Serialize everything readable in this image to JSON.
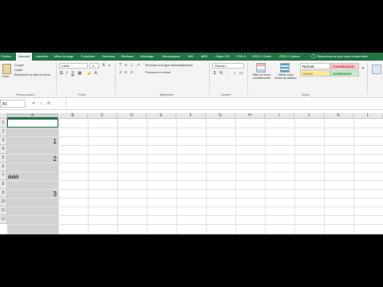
{
  "tabs": [
    {
      "label": "Fichier",
      "active": false
    },
    {
      "label": "Accueil",
      "active": true
    },
    {
      "label": "Insertion",
      "active": false
    },
    {
      "label": "Mise en page",
      "active": false
    },
    {
      "label": "Formules",
      "active": false
    },
    {
      "label": "Données",
      "active": false
    },
    {
      "label": "Révision",
      "active": false
    },
    {
      "label": "Affichage",
      "active": false
    },
    {
      "label": "Développeur",
      "active": false
    },
    {
      "label": "MR",
      "active": false
    },
    {
      "label": "MR2",
      "active": false
    },
    {
      "label": "Super FiC",
      "active": false
    },
    {
      "label": "OSS-X",
      "active": false
    },
    {
      "label": "OSS-Y Outils",
      "active": false
    },
    {
      "label": "OSS-Y Cycles",
      "active": false
    }
  ],
  "tell_me": "Dites-nous ce que vous voulez faire",
  "ribbon": {
    "clipboard": {
      "paste": "Coller",
      "cut": "Couper",
      "copy": "Copier",
      "format_painter": "Reproduire la mise en forme",
      "label": "Presse-papiers"
    },
    "font": {
      "name": "Calibri",
      "size": "11",
      "label": "Police"
    },
    "alignment": {
      "wrap": "Renvoyer à la ligne automatiquement",
      "merge": "Fusionner et centrer",
      "label": "Alignement"
    },
    "number": {
      "format": "Standard",
      "label": "Nombre"
    },
    "styles": {
      "conditional": "Mise en forme conditionnelle",
      "as_table": "Mettre sous forme de tableau",
      "normal": "Normal",
      "insuffisant": "Insatisfaisant",
      "neutre": "Neutre",
      "satisfaisant": "Satisfaisant",
      "label": "Styles"
    }
  },
  "formula_bar": {
    "name_box": "A1",
    "fx": "fx",
    "content": ""
  },
  "columns": [
    "A",
    "B",
    "C",
    "D",
    "E",
    "F",
    "G",
    "H",
    "I",
    "J",
    "K",
    "L"
  ],
  "rows": [
    "1",
    "2",
    "3",
    "4",
    "5",
    "6",
    "7",
    "8",
    "9",
    "10",
    "11",
    "12"
  ],
  "cells": [
    {
      "row": 3,
      "col": "A",
      "value": "1",
      "align": "right"
    },
    {
      "row": 5,
      "col": "A",
      "value": "2",
      "align": "right"
    },
    {
      "row": 7,
      "col": "A",
      "value": "aaa",
      "align": "left"
    },
    {
      "row": 9,
      "col": "A",
      "value": "3",
      "align": "right"
    }
  ],
  "colors": {
    "accent": "#217346",
    "selection": "#d2d2d2"
  }
}
